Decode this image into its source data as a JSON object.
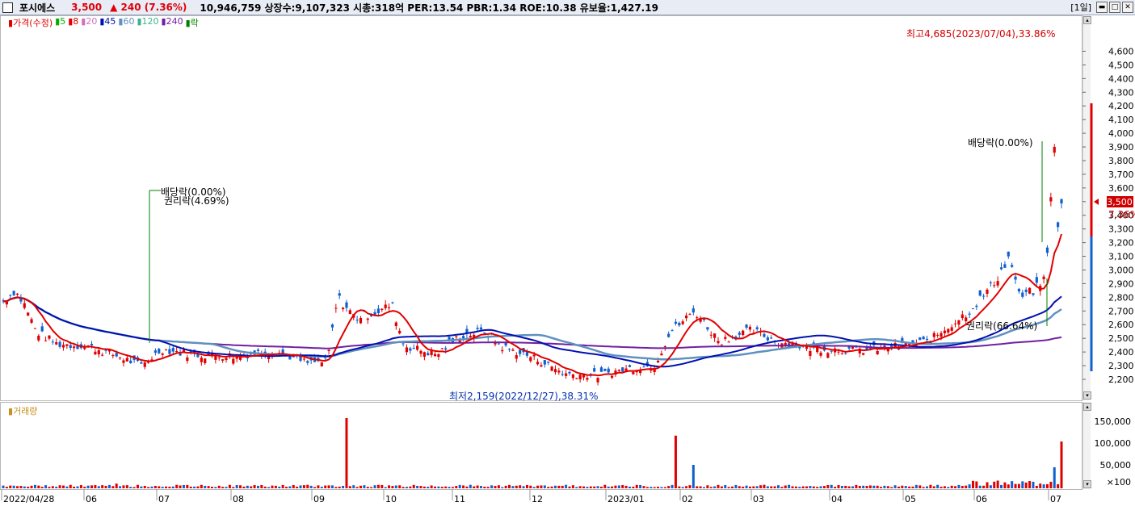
{
  "header": {
    "stock_name": "포시에스",
    "price": "3,500",
    "change": "▲ 240",
    "change_pct": "(7.36%)",
    "info": "10,946,759  상장수:9,107,323  시총:318억  PER:13.54  PBR:1.34  ROE:10.38  유보율:1,427.19",
    "period": "[1일]"
  },
  "legend": {
    "price_label": "가격(수정)",
    "ma": [
      {
        "label": "5",
        "color": "#00b000"
      },
      {
        "label": "8",
        "color": "#e00000"
      },
      {
        "label": "20",
        "color": "#d070c0"
      },
      {
        "label": "45",
        "color": "#0010b0"
      },
      {
        "label": "60",
        "color": "#6090c0"
      },
      {
        "label": "120",
        "color": "#40b090"
      },
      {
        "label": "240",
        "color": "#7020a0"
      },
      {
        "label": "락",
        "color": "#008000"
      }
    ]
  },
  "volume_label": "거래량",
  "annotations": {
    "high": "최고4,685(2023/07/04),33.86%",
    "low": "최저2,159(2022/12/27),38.31%",
    "div1": "배당락(0.00%)",
    "rights1": "권리락(4.69%)",
    "div2": "배당락(0.00%)",
    "rights2": "권리락(66.64%)",
    "last_price_tag": "3,500",
    "last_pct_tag": "7.36%"
  },
  "price_axis": {
    "labels": [
      "4,600",
      "4,500",
      "4,400",
      "4,300",
      "4,200",
      "4,100",
      "4,000",
      "3,900",
      "3,800",
      "3,700",
      "3,600",
      "3,500",
      "3,400",
      "3,300",
      "3,200",
      "3,100",
      "3,000",
      "2,900",
      "2,800",
      "2,700",
      "2,600",
      "2,500",
      "2,400",
      "2,300",
      "2,200"
    ]
  },
  "volume_axis": {
    "labels": [
      "150,000",
      "100,000",
      "50,000",
      "×100"
    ]
  },
  "date_axis": {
    "labels": [
      "2022/04/28",
      "06",
      "07",
      "08",
      "09",
      "10",
      "11",
      "12",
      "2023/01",
      "02",
      "03",
      "04",
      "05",
      "06",
      "07"
    ]
  },
  "colors": {
    "up": "#e00000",
    "down": "#1060d0",
    "ma8": "#e00000",
    "ma45": "#0010b0",
    "ma60": "#6090c0",
    "ma240": "#7020a0"
  }
}
